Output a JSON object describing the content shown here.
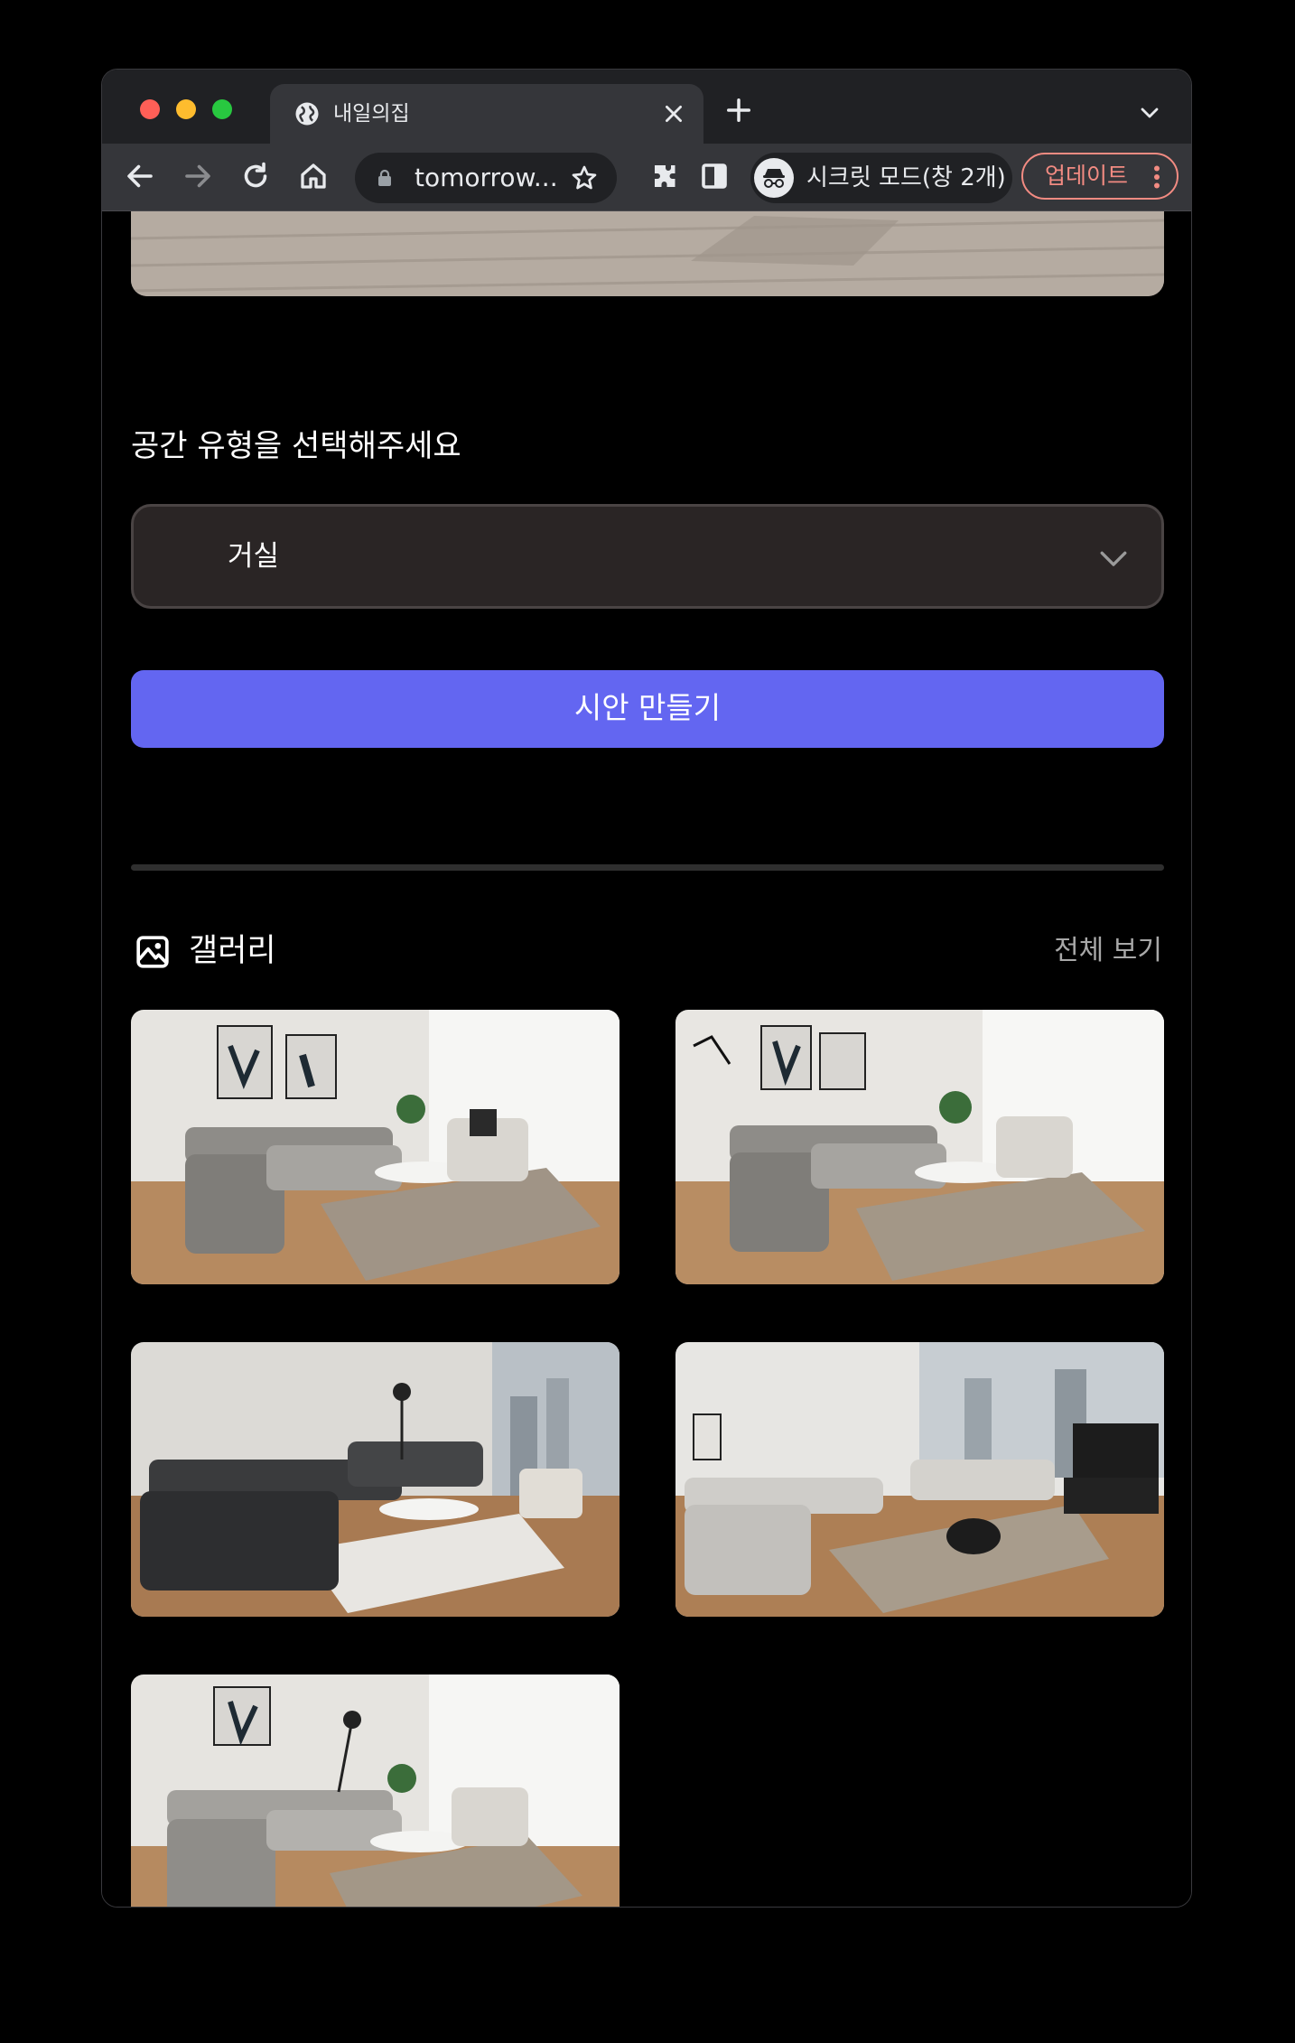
{
  "browser": {
    "tab_title": "내일의집",
    "url": "tomorrow...",
    "incognito_label": "시크릿 모드(창 2개)",
    "update_label": "업데이트"
  },
  "form": {
    "space_type_label": "공간 유형을 선택해주세요",
    "space_type_value": "거실",
    "create_button": "시안 만들기"
  },
  "gallery": {
    "title": "갤러리",
    "see_all": "전체 보기",
    "items": [
      {
        "style": "gray-sectional-art"
      },
      {
        "style": "gray-sectional-art-2"
      },
      {
        "style": "dark-sectional-city"
      },
      {
        "style": "light-sectional-tv"
      },
      {
        "style": "gray-sectional-art-3"
      }
    ]
  },
  "colors": {
    "accent": "#6366f1",
    "update_accent": "#f28b82",
    "select_bg": "#2a2525"
  },
  "icons": [
    "globe-icon",
    "close-icon",
    "plus-icon",
    "chevron-down-icon",
    "back-icon",
    "forward-icon",
    "reload-icon",
    "home-icon",
    "lock-icon",
    "star-icon",
    "extensions-icon",
    "side-panel-icon",
    "incognito-icon",
    "kebab-menu-icon",
    "image-icon"
  ]
}
